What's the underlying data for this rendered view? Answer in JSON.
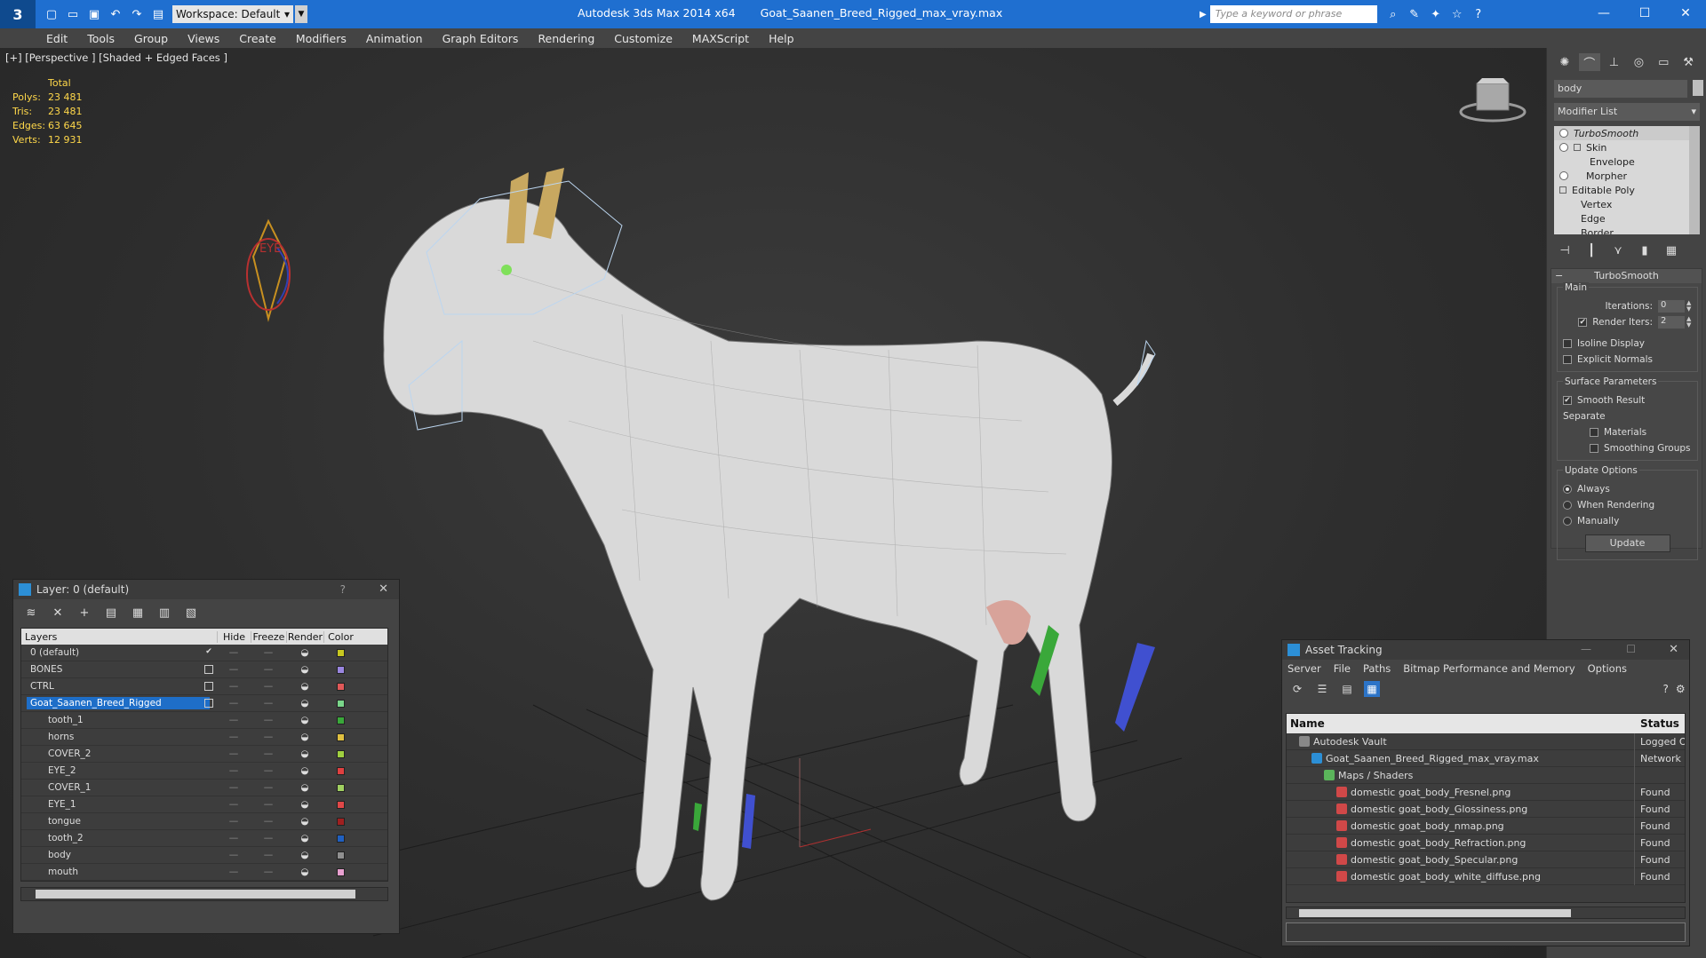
{
  "title": {
    "app": "Autodesk 3ds Max  2014 x64",
    "file": "Goat_Saanen_Breed_Rigged_max_vray.max",
    "workspace": "Workspace: Default",
    "search_placeholder": "Type a keyword or phrase"
  },
  "menu": [
    "Edit",
    "Tools",
    "Group",
    "Views",
    "Create",
    "Modifiers",
    "Animation",
    "Graph Editors",
    "Rendering",
    "Customize",
    "MAXScript",
    "Help"
  ],
  "viewport": {
    "label": "[+] [Perspective ] [Shaded + Edged Faces ]",
    "stats": {
      "header": "Total",
      "polys_label": "Polys:",
      "polys": "23 481",
      "tris_label": "Tris:",
      "tris": "23 481",
      "edges_label": "Edges:",
      "edges": "63 645",
      "verts_label": "Verts:",
      "verts": "12 931"
    },
    "eye_helper_label": "EYE"
  },
  "command_panel": {
    "object_name": "body",
    "modifier_list": "Modifier List",
    "stack": [
      {
        "label": "TurboSmooth",
        "italic": true
      },
      {
        "label": "Skin"
      },
      {
        "label": "Envelope"
      },
      {
        "label": "Morpher"
      },
      {
        "label": "Editable Poly"
      },
      {
        "label": "Vertex"
      },
      {
        "label": "Edge"
      },
      {
        "label": "Border"
      }
    ],
    "rollout": {
      "title": "TurboSmooth",
      "main_group": "Main",
      "iterations_label": "Iterations:",
      "iterations": "0",
      "render_iters_label": "Render Iters:",
      "render_iters": "2",
      "render_iters_checked": true,
      "isoline_display": "Isoline Display",
      "explicit_normals": "Explicit Normals",
      "surface_group": "Surface Parameters",
      "smooth_result": "Smooth Result",
      "separate": "Separate",
      "materials": "Materials",
      "smoothing_groups": "Smoothing Groups",
      "update_group": "Update Options",
      "always": "Always",
      "when_rendering": "When Rendering",
      "manually": "Manually",
      "update_button": "Update"
    }
  },
  "layer_dialog": {
    "title": "Layer: 0 (default)",
    "help": "?",
    "columns": [
      "Layers",
      "Hide",
      "Freeze",
      "Render",
      "Color"
    ],
    "rows": [
      {
        "name": "0 (default)",
        "level": 0,
        "active": true,
        "color": "#c8c820"
      },
      {
        "name": "BONES",
        "level": 0,
        "color": "#9a86e0"
      },
      {
        "name": "CTRL",
        "level": 0,
        "color": "#e05858"
      },
      {
        "name": "Goat_Saanen_Breed_Rigged",
        "level": 0,
        "selected": true,
        "color": "#7ad68a"
      },
      {
        "name": "tooth_1",
        "level": 1,
        "color": "#3aa83a"
      },
      {
        "name": "horns",
        "level": 1,
        "color": "#e0c040"
      },
      {
        "name": "COVER_2",
        "level": 1,
        "color": "#a0d040"
      },
      {
        "name": "EYE_2",
        "level": 1,
        "color": "#e04040"
      },
      {
        "name": "COVER_1",
        "level": 1,
        "color": "#a0d060"
      },
      {
        "name": "EYE_1",
        "level": 1,
        "color": "#e04848"
      },
      {
        "name": "tongue",
        "level": 1,
        "color": "#a02020"
      },
      {
        "name": "tooth_2",
        "level": 1,
        "color": "#2060c0"
      },
      {
        "name": "body",
        "level": 1,
        "color": "#909090"
      },
      {
        "name": "mouth",
        "level": 1,
        "color": "#e8a0d0"
      }
    ]
  },
  "asset_tracking": {
    "title": "Asset Tracking",
    "menu": [
      "Server",
      "File",
      "Paths",
      "Bitmap Performance and Memory",
      "Options"
    ],
    "col_name": "Name",
    "col_status": "Status",
    "rows": [
      {
        "name": "Autodesk Vault",
        "status": "Logged Ou",
        "indent": 1,
        "icon": "vault"
      },
      {
        "name": "Goat_Saanen_Breed_Rigged_max_vray.max",
        "status": "Network P",
        "indent": 2,
        "icon": "max"
      },
      {
        "name": "Maps / Shaders",
        "status": "",
        "indent": 3,
        "icon": "folder"
      },
      {
        "name": "domestic goat_body_Fresnel.png",
        "status": "Found",
        "indent": 4,
        "icon": "png"
      },
      {
        "name": "domestic goat_body_Glossiness.png",
        "status": "Found",
        "indent": 4,
        "icon": "png"
      },
      {
        "name": "domestic goat_body_nmap.png",
        "status": "Found",
        "indent": 4,
        "icon": "png"
      },
      {
        "name": "domestic goat_body_Refraction.png",
        "status": "Found",
        "indent": 4,
        "icon": "png"
      },
      {
        "name": "domestic goat_body_Specular.png",
        "status": "Found",
        "indent": 4,
        "icon": "png"
      },
      {
        "name": "domestic goat_body_white_diffuse.png",
        "status": "Found",
        "indent": 4,
        "icon": "png"
      }
    ]
  }
}
